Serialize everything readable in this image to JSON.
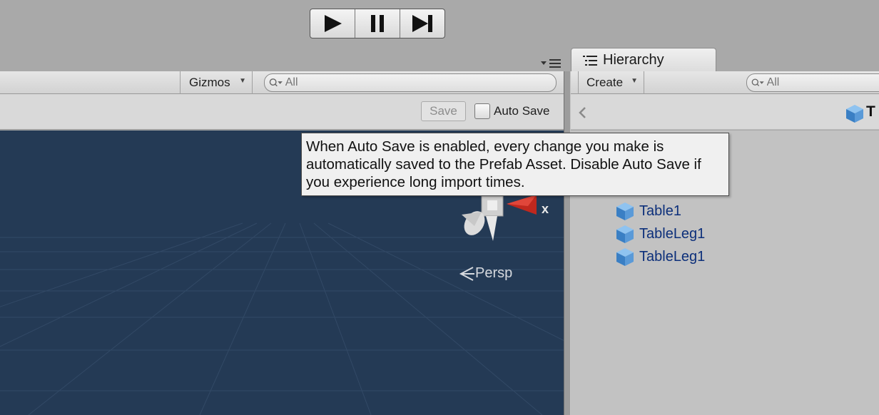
{
  "toolbar": {
    "play_icon": "play-icon",
    "pause_icon": "pause-icon",
    "step_icon": "step-icon"
  },
  "scene": {
    "gizmos_label": "Gizmos",
    "search_placeholder": "All",
    "save_label": "Save",
    "auto_save_label": "Auto Save",
    "auto_save_checked": false,
    "persp_label": "Persp",
    "axis_x_label": "x"
  },
  "tooltip": {
    "text": "When Auto Save is enabled, every change you make is automatically saved to the Prefab Asset. Disable Auto Save if you experience long import times."
  },
  "hierarchy": {
    "tab_label": "Hierarchy",
    "create_label": "Create",
    "search_placeholder": "All",
    "breadcrumb_label": "T",
    "items": [
      {
        "label": "Table1"
      },
      {
        "label": "TableLeg1"
      },
      {
        "label": "TableLeg1"
      }
    ]
  },
  "colors": {
    "viewport_bg": "#243a55",
    "hierarchy_item_text": "#0c2f7a",
    "gizmo_x_axis": "#c0281e"
  }
}
